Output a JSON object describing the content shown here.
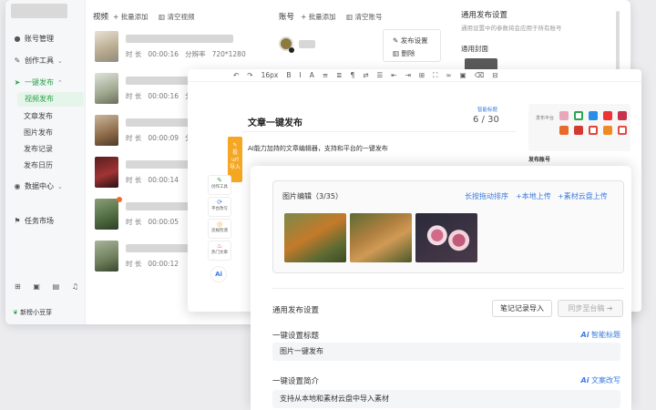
{
  "sidebar": {
    "items": [
      {
        "icon": "user-icon",
        "label": "账号管理"
      },
      {
        "icon": "wand-icon",
        "label": "创作工具"
      },
      {
        "icon": "send-icon",
        "label": "一键发布"
      }
    ],
    "sub_items": [
      "视频发布",
      "文章发布",
      "图片发布",
      "发布记录",
      "发布日历"
    ],
    "more_items": [
      {
        "icon": "data-icon",
        "label": "数据中心"
      },
      {
        "icon": "flag-icon",
        "label": "任务市场"
      }
    ],
    "brand": "新榜小豆芽"
  },
  "video_panel": {
    "header": "视频",
    "batch_add": "批量添加",
    "clear": "清空视频",
    "duration_label": "时 长",
    "resolution_label": "分辨率",
    "rows": [
      {
        "duration": "00:00:16",
        "resolution": "720*1280"
      },
      {
        "duration": "00:00:16",
        "resolution": ""
      },
      {
        "duration": "00:00:09",
        "resolution": ""
      },
      {
        "duration": "00:00:14",
        "resolution": ""
      },
      {
        "duration": "00:00:05",
        "resolution": ""
      },
      {
        "duration": "00:00:12",
        "resolution": ""
      }
    ]
  },
  "account_panel": {
    "header": "账号",
    "batch_add": "批量添加",
    "clear": "清空账号",
    "publish_settings": "发布设置",
    "delete": "删除"
  },
  "right_settings": {
    "title": "通用发布设置",
    "desc": "通用设置中的参数将会应用于所有账号",
    "cover_label": "通用封面"
  },
  "editor": {
    "toolbar": [
      "↶",
      "↷",
      "16px",
      "B",
      "I",
      "A",
      "≡",
      "≣",
      "¶",
      "⇄",
      "☰",
      "⇤",
      "⇥",
      "⊞",
      "⛶",
      "∞",
      "▣",
      "⌫",
      "⊟"
    ],
    "smart_tag": "智能标题",
    "title": "文章一键发布",
    "title_count": "6 / 30",
    "desc": "AI能力加持的文章编辑器，支持和平台的一键发布",
    "orange_tab": "投\nurl\n导入",
    "tools": [
      {
        "icon": "pen-icon",
        "label": "创作工具"
      },
      {
        "icon": "refresh-icon",
        "label": "平台改写"
      },
      {
        "icon": "check-icon",
        "label": "违规检测"
      },
      {
        "icon": "fire-icon",
        "label": "热门文章"
      }
    ],
    "ai": "Ai",
    "platform_label": "发布平台",
    "publish_account": "发布账号"
  },
  "front": {
    "image_box_title": "图片编辑（3/35）",
    "sort": "长按拖动排序",
    "local_upload": "+本地上传",
    "cloud_upload": "+素材云盘上传",
    "general_settings": "通用发布设置",
    "import_notes": "笔记记录导入",
    "sync_draft": "同步至台稿",
    "title_label": "一键设置标题",
    "title_ai": "智能标题",
    "title_value": "图片一键发布",
    "intro_label": "一键设置简介",
    "intro_ai": "文案改写",
    "intro_value": "支持从本地和素材云盘中导入素材",
    "ai_mark": "Ai"
  },
  "colors": {
    "accent_green": "#2ea34f",
    "link_blue": "#3a7be0",
    "editor_orange": "#f5a623"
  }
}
